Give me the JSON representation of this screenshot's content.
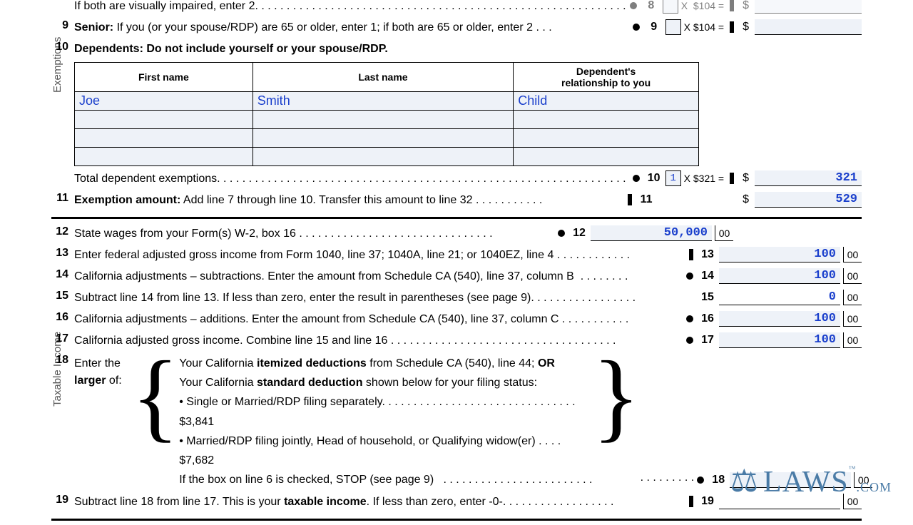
{
  "sections": {
    "exemptions": "Exemptions",
    "taxable": "Taxable Income"
  },
  "lines": {
    "l8_partial": "If both are visually impaired, enter 2",
    "l9_num": "9",
    "l9_label": "Senior:",
    "l9_text": " If you (or your spouse/RDP) are 65 or older, enter 1; if both are 65 or older, enter 2",
    "l9_calc": "X  $104 =",
    "l10_num": "10",
    "l10_label": "Dependents: Do not include yourself or your spouse/RDP.",
    "dep_h1": "First name",
    "dep_h2": "Last name",
    "dep_h3": "Dependent's\nrelationship to you",
    "dep_r1_fn": "Joe",
    "dep_r1_ln": "Smith",
    "dep_r1_rel": "Child",
    "l10b_text": "Total dependent exemptions",
    "l10b_num": "10",
    "l10b_box": "1",
    "l10b_calc": "X  $321 =",
    "l10b_amt": "321",
    "l11_num": "11",
    "l11_label": "Exemption amount:",
    "l11_text": " Add line 7 through line 10. Transfer this amount to line 32",
    "l11_amt": "529",
    "l12_num": "12",
    "l12_text": "State wages from your Form(s) W-2, box 16",
    "l12_amt": "50,000",
    "l13_num": "13",
    "l13_text": "Enter federal adjusted gross income from Form 1040, line 37; 1040A, line 21; or 1040EZ, line 4",
    "l13_amt": "100",
    "l14_num": "14",
    "l14_text": "California adjustments – subtractions. Enter the amount from Schedule CA (540), line 37, column B",
    "l14_amt": "100",
    "l15_num": "15",
    "l15_text": "Subtract line 14 from line 13. If less than zero, enter the result in parentheses (see page 9)",
    "l15_amt": "0",
    "l16_num": "16",
    "l16_text": "California adjustments – additions. Enter the amount from Schedule CA (540), line 37, column C",
    "l16_amt": "100",
    "l17_num": "17",
    "l17_text": "California adjusted gross income. Combine line 15 and line 16",
    "l17_amt": "100",
    "l18_num": "18",
    "l18_left1": "Enter the",
    "l18_left2": "larger",
    "l18_left3": " of:",
    "l18_a1": "Your California ",
    "l18_a2": "itemized deductions",
    "l18_a3": " from Schedule CA (540), line 44; ",
    "l18_a4": "OR",
    "l18_b1": "Your California ",
    "l18_b2": "standard deduction",
    "l18_b3": " shown below for your filing status:",
    "l18_c": "• Single or Married/RDP filing separately. . . . . . . . . . . . . . . . . . . . . . . . . . . . . . .  $3,841",
    "l18_d": "• Married/RDP filing jointly, Head of household, or Qualifying widow(er)  . . . .  $7,682",
    "l18_e": "If the box on line 6 is checked, STOP (see page 9)",
    "l19_num": "19",
    "l19_a": "Subtract line 18 from line 17. This is your ",
    "l19_b": "taxable income",
    "l19_c": ". If less than zero, enter -0-",
    "cents": "00"
  },
  "watermark": {
    "brand": "LAWS",
    "suffix": ".COM",
    "tm": "™"
  }
}
